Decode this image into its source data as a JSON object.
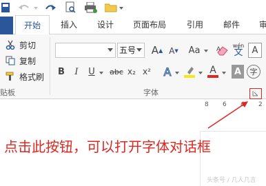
{
  "tabs": [
    {
      "label": "开始",
      "active": true
    },
    {
      "label": "插入"
    },
    {
      "label": "设计"
    },
    {
      "label": "页面布局"
    },
    {
      "label": "引用"
    },
    {
      "label": "邮件"
    },
    {
      "label": "审"
    }
  ],
  "clipboard": {
    "cut": "剪切",
    "copy": "复制",
    "format_painter": "格式刷",
    "group_label": "贴板"
  },
  "font": {
    "name_value": "",
    "size_value": "五号",
    "grow": "A",
    "shrink": "A",
    "case": "Aa",
    "pinyin_top": "wén",
    "pinyin_bottom": "文",
    "bold": "B",
    "italic": "I",
    "underline": "U",
    "strike": "abc",
    "subscript": "x₂",
    "superscript": "x²",
    "effects": "A",
    "font_color": "A",
    "shading": "A",
    "enclose": "字",
    "group_label": "字体"
  },
  "ruler": [
    "8",
    "6",
    "4",
    "2"
  ],
  "annotation": "点击此按钮，可以打开字体对话框",
  "watermark": "头条号 / 几人几言",
  "colors": {
    "accent": "#2b579a",
    "annotation": "#e0261f",
    "highlight": "#f5e71a",
    "font_color_bar": "#e0261f"
  }
}
